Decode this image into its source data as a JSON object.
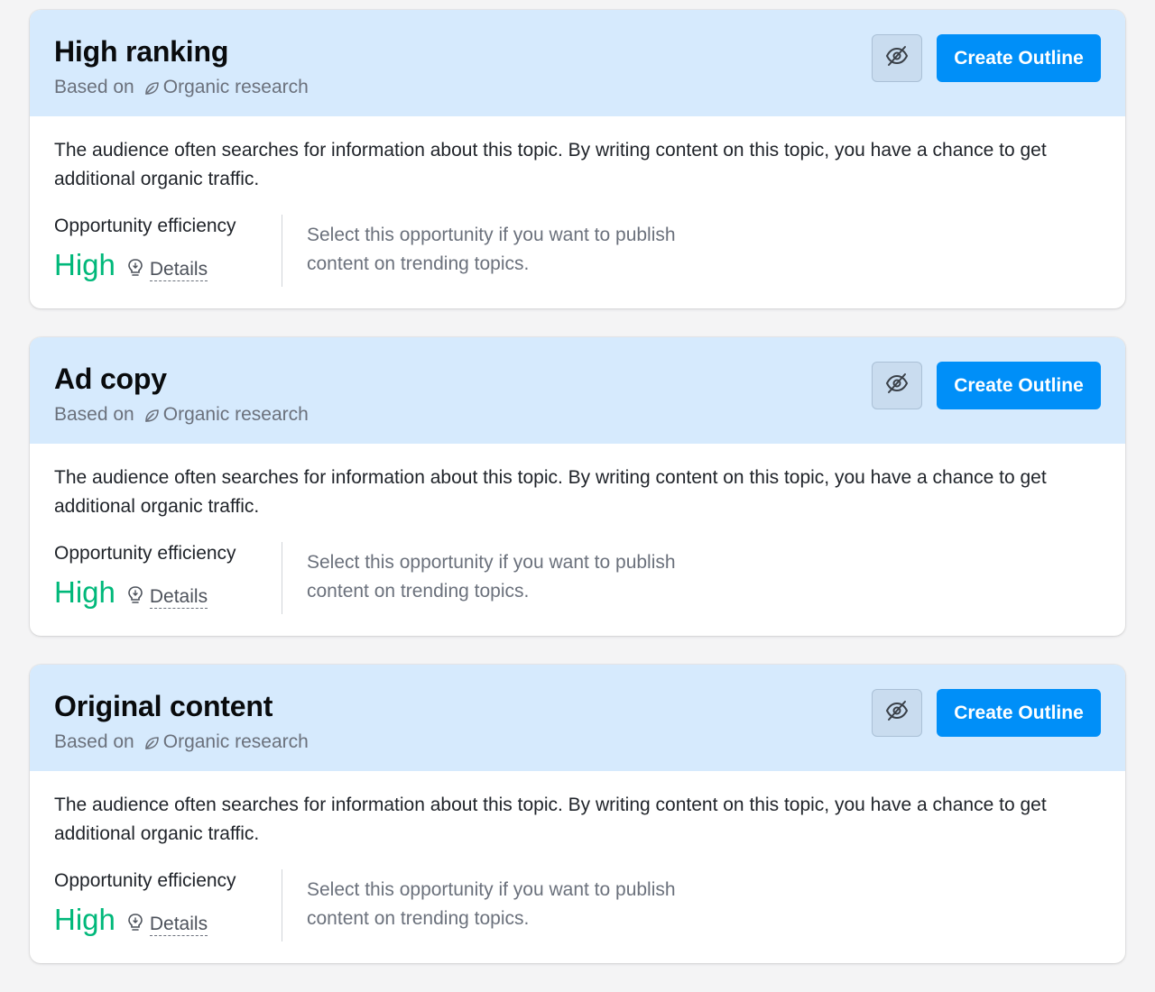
{
  "cards": [
    {
      "title": "High ranking",
      "based_on_prefix": "Based on",
      "source": "Organic research",
      "create_label": "Create Outline",
      "description": "The audience often searches for information about this topic. By writing content on this topic, you have a chance to get additional organic traffic.",
      "efficiency_label": "Opportunity efficiency",
      "efficiency_value": "High",
      "details_label": "Details",
      "hint": "Select this opportunity if you want to publish content on trending topics."
    },
    {
      "title": "Ad copy",
      "based_on_prefix": "Based on",
      "source": "Organic research",
      "create_label": "Create Outline",
      "description": "The audience often searches for information about this topic. By writing content on this topic, you have a chance to get additional organic traffic.",
      "efficiency_label": "Opportunity efficiency",
      "efficiency_value": "High",
      "details_label": "Details",
      "hint": "Select this opportunity if you want to publish content on trending topics."
    },
    {
      "title": "Original content",
      "based_on_prefix": "Based on",
      "source": "Organic research",
      "create_label": "Create Outline",
      "description": "The audience often searches for information about this topic. By writing content on this topic, you have a chance to get additional organic traffic.",
      "efficiency_label": "Opportunity efficiency",
      "efficiency_value": "High",
      "details_label": "Details",
      "hint": "Select this opportunity if you want to publish content on trending topics."
    }
  ],
  "icons": {
    "source": "leaf-icon",
    "hide": "eye-slash-icon",
    "details": "lightbulb-icon"
  },
  "colors": {
    "header_bg": "#d6eafd",
    "primary_button": "#008ff8",
    "efficiency_high": "#00b87a"
  }
}
